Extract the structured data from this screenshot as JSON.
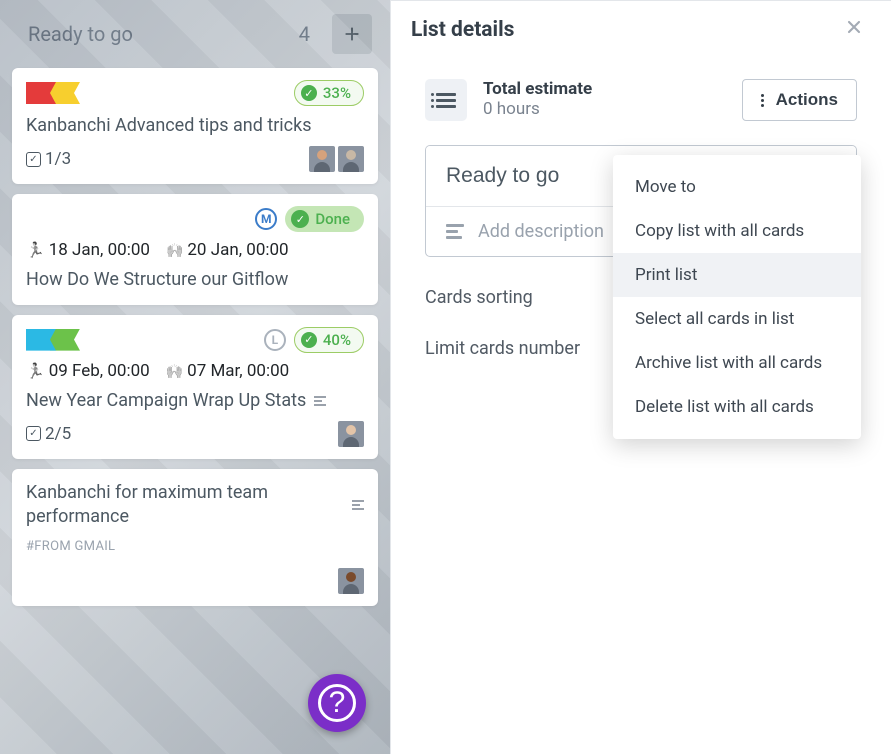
{
  "column": {
    "title": "Ready to go",
    "count": "4"
  },
  "cards": [
    {
      "progress": "33%",
      "title": "Kanbanchi Advanced tips and tricks",
      "checklist": "1/3"
    },
    {
      "done_label": "Done",
      "start_date": "18 Jan, 00:00",
      "end_date": "20 Jan, 00:00",
      "title": "How Do We Structure our Gitflow"
    },
    {
      "progress": "40%",
      "start_date": "09 Feb, 00:00",
      "end_date": "07 Mar, 00:00",
      "title": "New Year Campaign Wrap Up Stats",
      "checklist": "2/5"
    },
    {
      "title": "Kanbanchi for maximum team performance",
      "tag": "#FROM GMAIL"
    }
  ],
  "panel": {
    "title": "List details",
    "estimate_label": "Total estimate",
    "estimate_value": "0 hours",
    "actions_label": "Actions",
    "list_name": "Ready to go",
    "desc_placeholder": "Add description",
    "sorting_label": "Cards sorting",
    "limit_label": "Limit cards number"
  },
  "menu": {
    "items": [
      "Move to",
      "Copy list with all cards",
      "Print list",
      "Select all cards in list",
      "Archive list with all cards",
      "Delete list with all cards"
    ]
  }
}
